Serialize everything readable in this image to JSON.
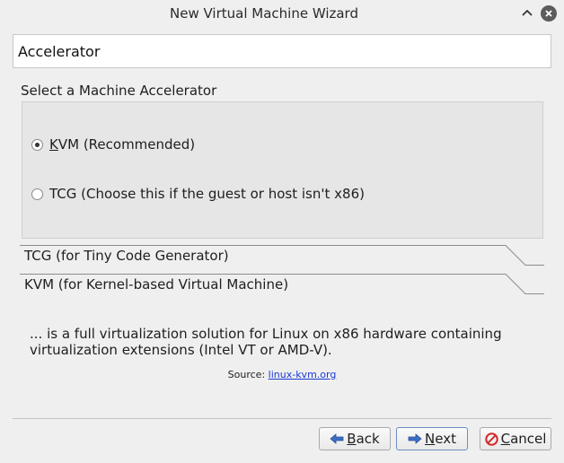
{
  "window": {
    "title": "New Virtual Machine Wizard"
  },
  "page": {
    "header": "Accelerator"
  },
  "accelerator_group": {
    "title": "Select a Machine Accelerator",
    "options": [
      {
        "mnemonic": "K",
        "rest": "VM (Recommended)",
        "selected": true
      },
      {
        "prefix": "TCG (Choose this if the ",
        "mnemonic": "g",
        "rest": "uest or host isn't x86)",
        "selected": false
      }
    ]
  },
  "sections": {
    "tcg_label": "TCG (for Tiny Code Generator)",
    "kvm_label": "KVM (for Kernel-based Virtual Machine)"
  },
  "description": {
    "text": "... is a full virtualization solution for Linux on x86 hardware containing virtualization extensions (Intel VT or AMD-V).",
    "source_prefix": "Source: ",
    "source_link": "linux-kvm.org"
  },
  "buttons": {
    "back_mnemonic": "B",
    "back_rest": "ack",
    "next_mnemonic": "N",
    "next_rest": "ext",
    "cancel_mnemonic": "C",
    "cancel_rest": "ancel"
  },
  "colors": {
    "arrow_blue": "#3a6fc4",
    "cancel_red": "#d22b2b"
  }
}
